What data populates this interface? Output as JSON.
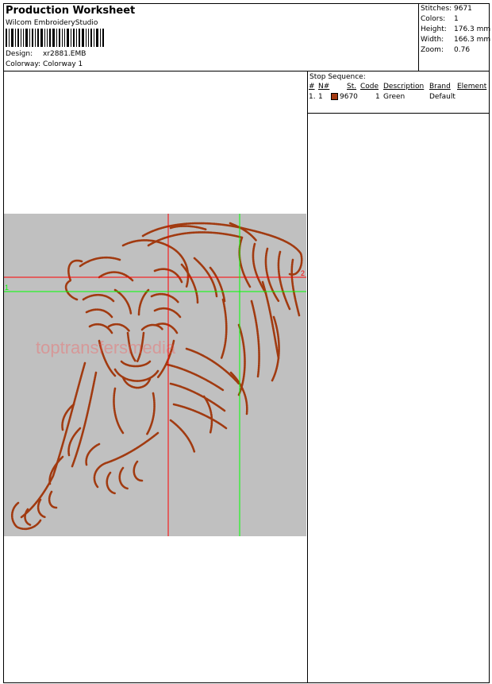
{
  "header": {
    "title": "Production Worksheet",
    "company": "Wilcom  EmbroideryStudio",
    "design_label": "Design:",
    "design_value": "xr2881.EMB",
    "colorway_label": "Colorway:",
    "colorway_value": "Colorway 1"
  },
  "stats": [
    {
      "label": "Stitches:",
      "value": "9671"
    },
    {
      "label": "Colors:",
      "value": "1"
    },
    {
      "label": "Height:",
      "value": "176.3 mm"
    },
    {
      "label": "Width:",
      "value": "166.3 mm"
    },
    {
      "label": "Zoom:",
      "value": "0.76"
    }
  ],
  "stop_sequence": {
    "title": "Stop Sequence:",
    "headers": [
      "#",
      "N#",
      "St.",
      "Code",
      "Description",
      "Brand",
      "Element"
    ],
    "rows": [
      {
        "num": "1.",
        "n": "1",
        "code": "9670",
        "st": "1",
        "description": "Green",
        "brand": "Default",
        "element": "",
        "color": "#a33a12"
      }
    ]
  },
  "design": {
    "thread_color": "#a13a10",
    "background_color": "#c0c0c0",
    "guide_red": "#ff0000",
    "guide_green": "#00ff00",
    "marker_1": "1",
    "marker_2": "2",
    "watermark": "toptransfersmedia"
  }
}
